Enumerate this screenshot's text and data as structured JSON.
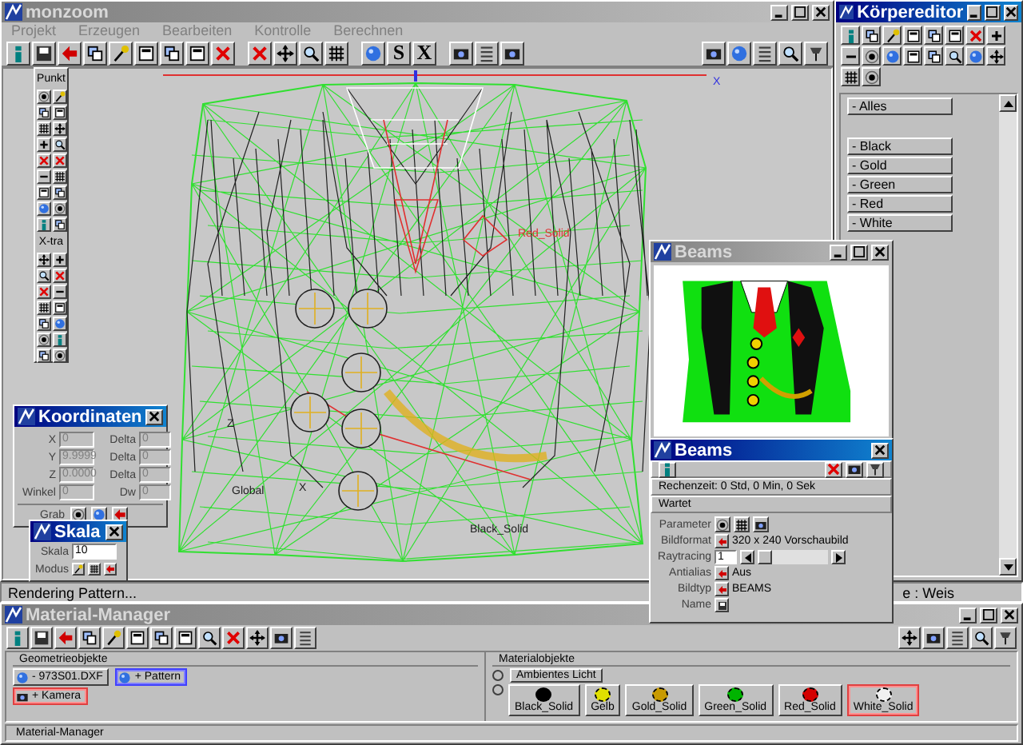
{
  "main_window": {
    "title": "monzoom",
    "active": false,
    "menu": [
      "Projekt",
      "Erzeugen",
      "Bearbeiten",
      "Kontrolle",
      "Berechnen"
    ],
    "toolbar_letters": [
      "S",
      "X"
    ],
    "viewport_labels": [
      "X",
      "Red_Solid",
      "Z",
      "X",
      "Global",
      "Black_Solid"
    ],
    "status": "Rendering Pattern...",
    "status_right": "e : Weis"
  },
  "toolbox": {
    "sections": [
      "Punkt",
      "X-tra"
    ]
  },
  "koordinaten": {
    "title": "Koordinaten",
    "active": true,
    "rows": [
      {
        "label": "X",
        "value": "0",
        "delta_label": "Delta",
        "delta": "0"
      },
      {
        "label": "Y",
        "value": "9.9999",
        "delta_label": "Delta",
        "delta": "0"
      },
      {
        "label": "Z",
        "value": "0.0000",
        "delta_label": "Delta",
        "delta": "0"
      },
      {
        "label": "Winkel",
        "value": "0",
        "delta_label": "Dw",
        "delta": "0"
      }
    ],
    "disabled": true,
    "grab_label": "Grab"
  },
  "skala": {
    "title": "Skala",
    "active": true,
    "skala_label": "Skala",
    "skala_value": "10",
    "modus_label": "Modus"
  },
  "koerpereditor": {
    "title": "Körpereditor",
    "active": true,
    "items": [
      {
        "label": "- Alles",
        "kind": "all"
      },
      {
        "label": "- Black",
        "kind": "body"
      },
      {
        "label": "- Gold",
        "kind": "body"
      },
      {
        "label": "- Green",
        "kind": "body"
      },
      {
        "label": "- Red",
        "kind": "body"
      },
      {
        "label": "- White",
        "kind": "body"
      }
    ]
  },
  "beams_preview": {
    "title": "Beams",
    "active": false
  },
  "beams_dialog": {
    "title": "Beams",
    "active": true,
    "time": "Rechenzeit: 0 Std, 0 Min, 0 Sek",
    "state": "Wartet",
    "parameter_label": "Parameter",
    "bildformat_label": "Bildformat",
    "bildformat": "320 x 240 Vorschaubild",
    "raytracing_label": "Raytracing",
    "raytracing": "1",
    "raytracing_slider": {
      "level": 0
    },
    "antialias_label": "Antialias",
    "antialias": "Aus",
    "bildtyp_label": "Bildtyp",
    "bildtyp": "BEAMS",
    "name_label": "Name"
  },
  "material_manager": {
    "title": "Material-Manager",
    "active": false,
    "geometry_header": "Geometrieobjekte",
    "geometry": [
      {
        "label": "- 973S01.DXF",
        "kind": "object",
        "selected": false,
        "marked": false
      },
      {
        "label": "+ Pattern",
        "kind": "object",
        "selected": true,
        "marked": false
      },
      {
        "label": "+ Kamera",
        "kind": "camera",
        "selected": false,
        "marked": true
      }
    ],
    "material_header": "Materialobjekte",
    "ambient": "Ambientes Licht",
    "ambient_radio": {
      "checked": false
    },
    "materials_radio": {
      "checked": false
    },
    "materials": [
      {
        "label": "Black_Solid",
        "color": "#000000",
        "marked": false
      },
      {
        "label": "Gelb",
        "color": "#e0e000",
        "marked": false
      },
      {
        "label": "Gold_Solid",
        "color": "#c89a00",
        "marked": false
      },
      {
        "label": "Green_Solid",
        "color": "#00b400",
        "marked": false
      },
      {
        "label": "Red_Solid",
        "color": "#d40000",
        "marked": false
      },
      {
        "label": "White_Solid",
        "color": "#f0f0f0",
        "marked": true
      }
    ],
    "status": "Material-Manager"
  }
}
